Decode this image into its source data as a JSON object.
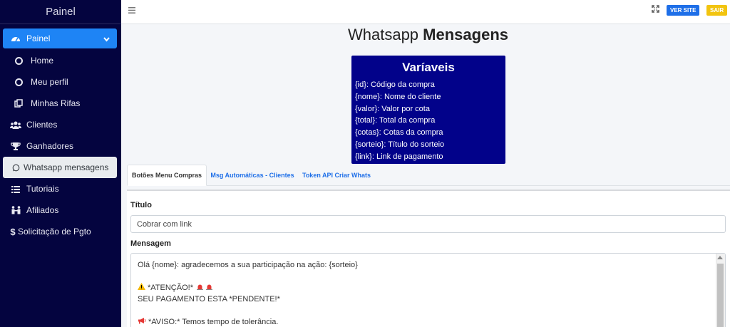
{
  "sidebar": {
    "brand": "Painel",
    "active_group": "Painel",
    "items": [
      {
        "label": "Home",
        "icon": "circle-icon"
      },
      {
        "label": "Meu perfil",
        "icon": "circle-icon"
      },
      {
        "label": "Minhas Rifas",
        "icon": "copy-icon"
      },
      {
        "label": "Clientes",
        "icon": "users-icon"
      },
      {
        "label": "Ganhadores",
        "icon": "trophy-icon"
      },
      {
        "label": "Whatsapp mensagens",
        "icon": "whatsapp-icon"
      },
      {
        "label": "Tutoriais",
        "icon": "list-icon"
      },
      {
        "label": "Afiliados",
        "icon": "people-icon"
      },
      {
        "label": "Solicitação de Pgto",
        "icon": "dollar-icon"
      }
    ]
  },
  "topbar": {
    "ver_site": "VER SITE",
    "sair": "SAIR"
  },
  "page": {
    "title_regular": "Whatsapp",
    "title_bold": "Mensagens"
  },
  "variables": {
    "title": "Varíaveis",
    "lines": [
      "{id}: Código da compra",
      "{nome}: Nome do cliente",
      "{valor}: Valor por cota",
      "{total}: Total da compra",
      "{cotas}: Cotas da compra",
      "{sorteio}: Título do sorteio",
      "{link}: Link de pagamento"
    ]
  },
  "tabs": [
    {
      "label": "Botões Menu Compras",
      "active": true
    },
    {
      "label": "Msg Automáticas - Clientes",
      "active": false
    },
    {
      "label": "Token API Criar Whats",
      "active": false
    }
  ],
  "form": {
    "title_label": "Título",
    "title_value": "Cobrar com link",
    "message_label": "Mensagem",
    "message_lines": [
      "Olá {nome}: agradecemos a sua participação na ação: {sorteio}",
      "",
      "*ATENÇÃO!*",
      "SEU PAGAMENTO ESTA *PENDENTE!*",
      "",
      "*AVISO:* Temos tempo de tolerância."
    ]
  },
  "colors": {
    "sidebar_bg": "#04043f",
    "active_nav": "#1e84f5",
    "variables_bg": "#02028a",
    "btn_site": "#1e6fe8",
    "btn_sair": "#f2c40f"
  }
}
